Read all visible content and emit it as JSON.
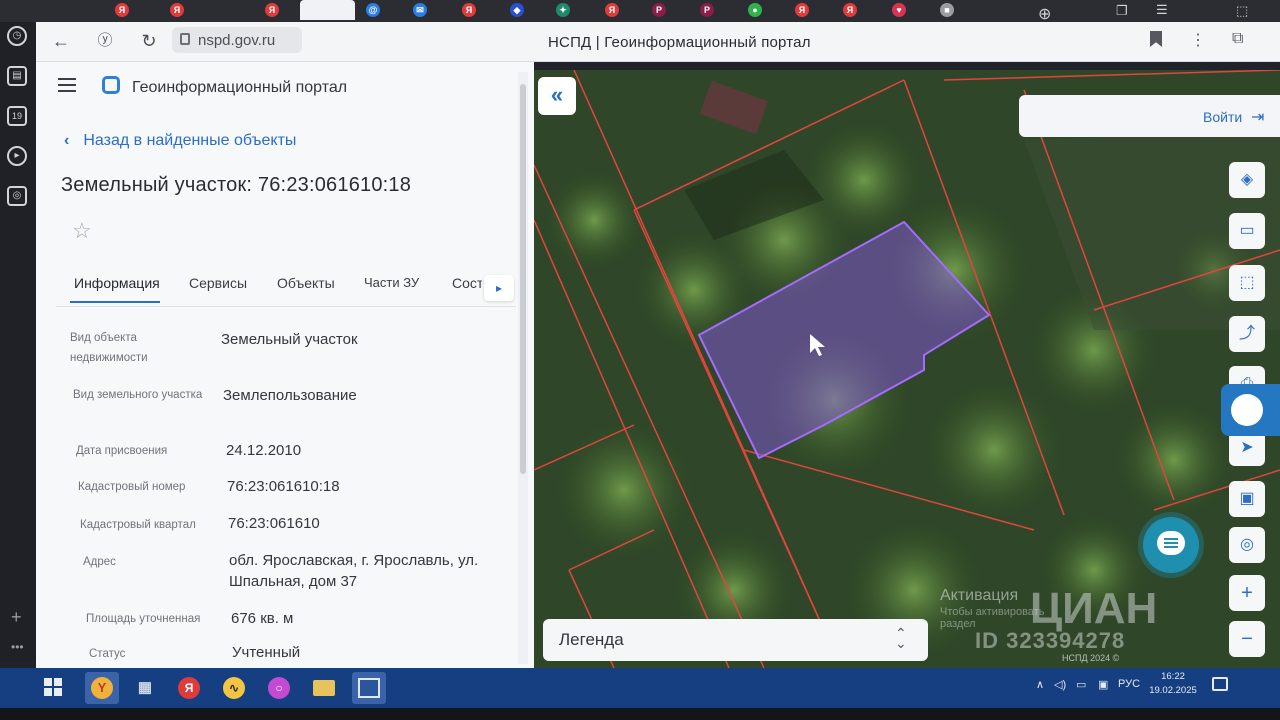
{
  "browser": {
    "url": "nspd.gov.ru",
    "page_title": "НСПД | Геоинформационный портал",
    "tab_icons": [
      {
        "letter": "Я",
        "color": "#e03b3b"
      },
      {
        "letter": "Я",
        "color": "#e03b3b"
      },
      {
        "letter": "Я",
        "color": "#e03b3b"
      },
      {
        "letter": "@",
        "color": "#2a7de1"
      },
      {
        "letter": "✉",
        "color": "#2a7de1"
      },
      {
        "letter": "Я",
        "color": "#e03b3b"
      },
      {
        "letter": "◆",
        "color": "#2a4fd1"
      },
      {
        "letter": "✦",
        "color": "#1e8a6d"
      },
      {
        "letter": "Я",
        "color": "#e03b3b"
      },
      {
        "letter": "P",
        "color": "#8a1d4a"
      },
      {
        "letter": "P",
        "color": "#8a1d4a"
      },
      {
        "letter": "●",
        "color": "#2fb34a"
      },
      {
        "letter": "Я",
        "color": "#e03b3b"
      },
      {
        "letter": "Я",
        "color": "#e03b3b"
      },
      {
        "letter": "♥",
        "color": "#d9334f"
      },
      {
        "letter": "■",
        "color": "#9a9ca3"
      }
    ]
  },
  "panel": {
    "portal_name": "Геоинформационный портал",
    "back_link": "Назад в найденные объекты",
    "title": "Земельный участок: 76:23:061610:18",
    "tabs": [
      "Информация",
      "Сервисы",
      "Объекты",
      "Части ЗУ",
      "Соста"
    ],
    "fields": [
      {
        "label": "Вид объекта недвижимости",
        "value": "Земельный участок"
      },
      {
        "label": "Вид земельного участка",
        "value": "Землепользование"
      },
      {
        "label": "Дата присвоения",
        "value": "24.12.2010"
      },
      {
        "label": "Кадастровый номер",
        "value": "76:23:061610:18"
      },
      {
        "label": "Кадастровый квартал",
        "value": "76:23:061610"
      },
      {
        "label": "Адрес",
        "value": "обл. Ярославская, г. Ярославль, ул. Шпальная, дом 37"
      },
      {
        "label": "Площадь уточненная",
        "value": "676 кв. м"
      },
      {
        "label": "Статус",
        "value": "Учтенный"
      }
    ]
  },
  "map": {
    "login_label": "Войти",
    "legend_label": "Легенда",
    "watermark_lines": [
      "Активация",
      "Чтобы активировать",
      "раздел"
    ],
    "watermark_brand": "ЦИАН",
    "watermark_id": "ID 323394278",
    "scale_text": "НСПД 2024 ©",
    "colors": {
      "parcel": "#9b5cff",
      "boundary": "#e2453f"
    }
  },
  "taskbar": {
    "tray_lang": "РУС",
    "time": "16:22",
    "date": "19.02.2025"
  }
}
